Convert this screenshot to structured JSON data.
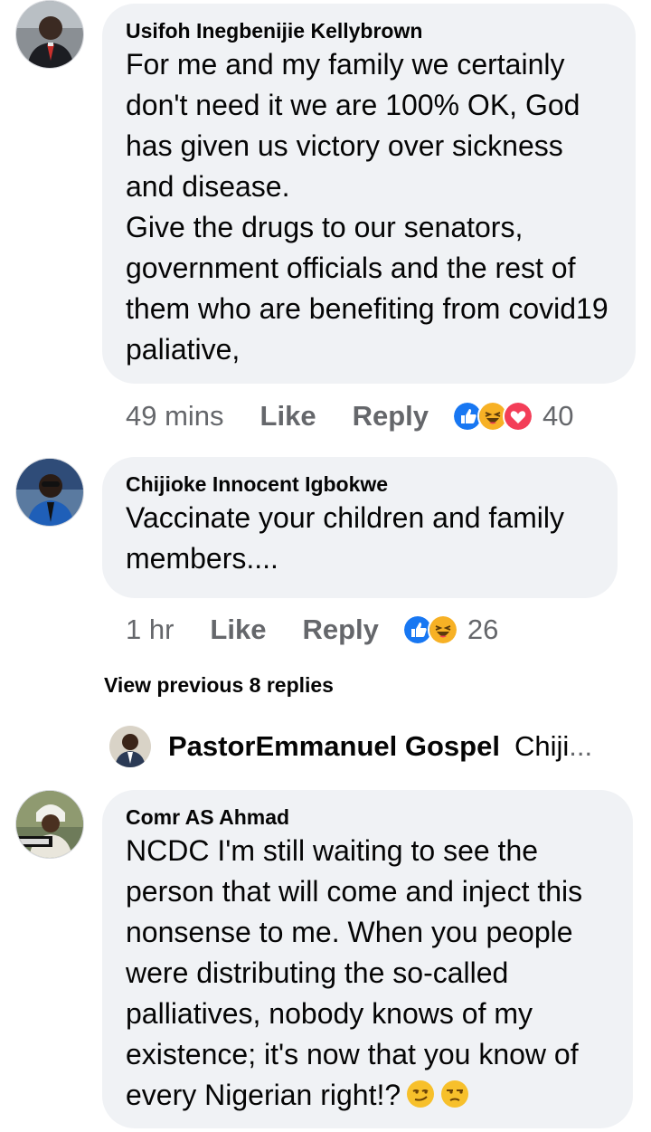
{
  "comments": [
    {
      "author": "Usifoh Inegbenijie Kellybrown",
      "paragraphs": [
        "For me and my family we certainly don't need it we are 100% OK,  God has given us victory over sickness and disease.",
        "Give the drugs to our senators, government officials and the rest of them who are benefiting from covid19 paliative,"
      ],
      "time": "49 mins",
      "like_label": "Like",
      "reply_label": "Reply",
      "reactions": [
        "like-icon",
        "haha-icon",
        "love-icon"
      ],
      "reaction_count": "40"
    },
    {
      "author": "Chijioke Innocent Igbokwe",
      "paragraphs": [
        "Vaccinate your children and family members...."
      ],
      "time": "1 hr",
      "like_label": "Like",
      "reply_label": "Reply",
      "reactions": [
        "like-icon",
        "haha-icon"
      ],
      "reaction_count": "26"
    },
    {
      "author": "Comr AS Ahmad",
      "paragraphs": [
        "NCDC I'm still waiting to see the person that will come and inject this nonsense to me. When you people were distributing the so-called palliatives, nobody knows of my existence; it's now that you know of every Nigerian right!?"
      ],
      "trailing_emojis": [
        "smirk-emoji",
        "unamused-emoji"
      ]
    }
  ],
  "view_previous": "View previous 8 replies",
  "reply_preview": {
    "author": "PastorEmmanuel Gospel",
    "snippet": "Chiji",
    "ellipsis": "..."
  },
  "colors": {
    "bubble": "#f0f2f5",
    "meta_text": "#65676b",
    "text": "#050505",
    "like_blue": "#1877f2",
    "haha_yellow": "#f7b125",
    "love_red": "#f33e58"
  }
}
